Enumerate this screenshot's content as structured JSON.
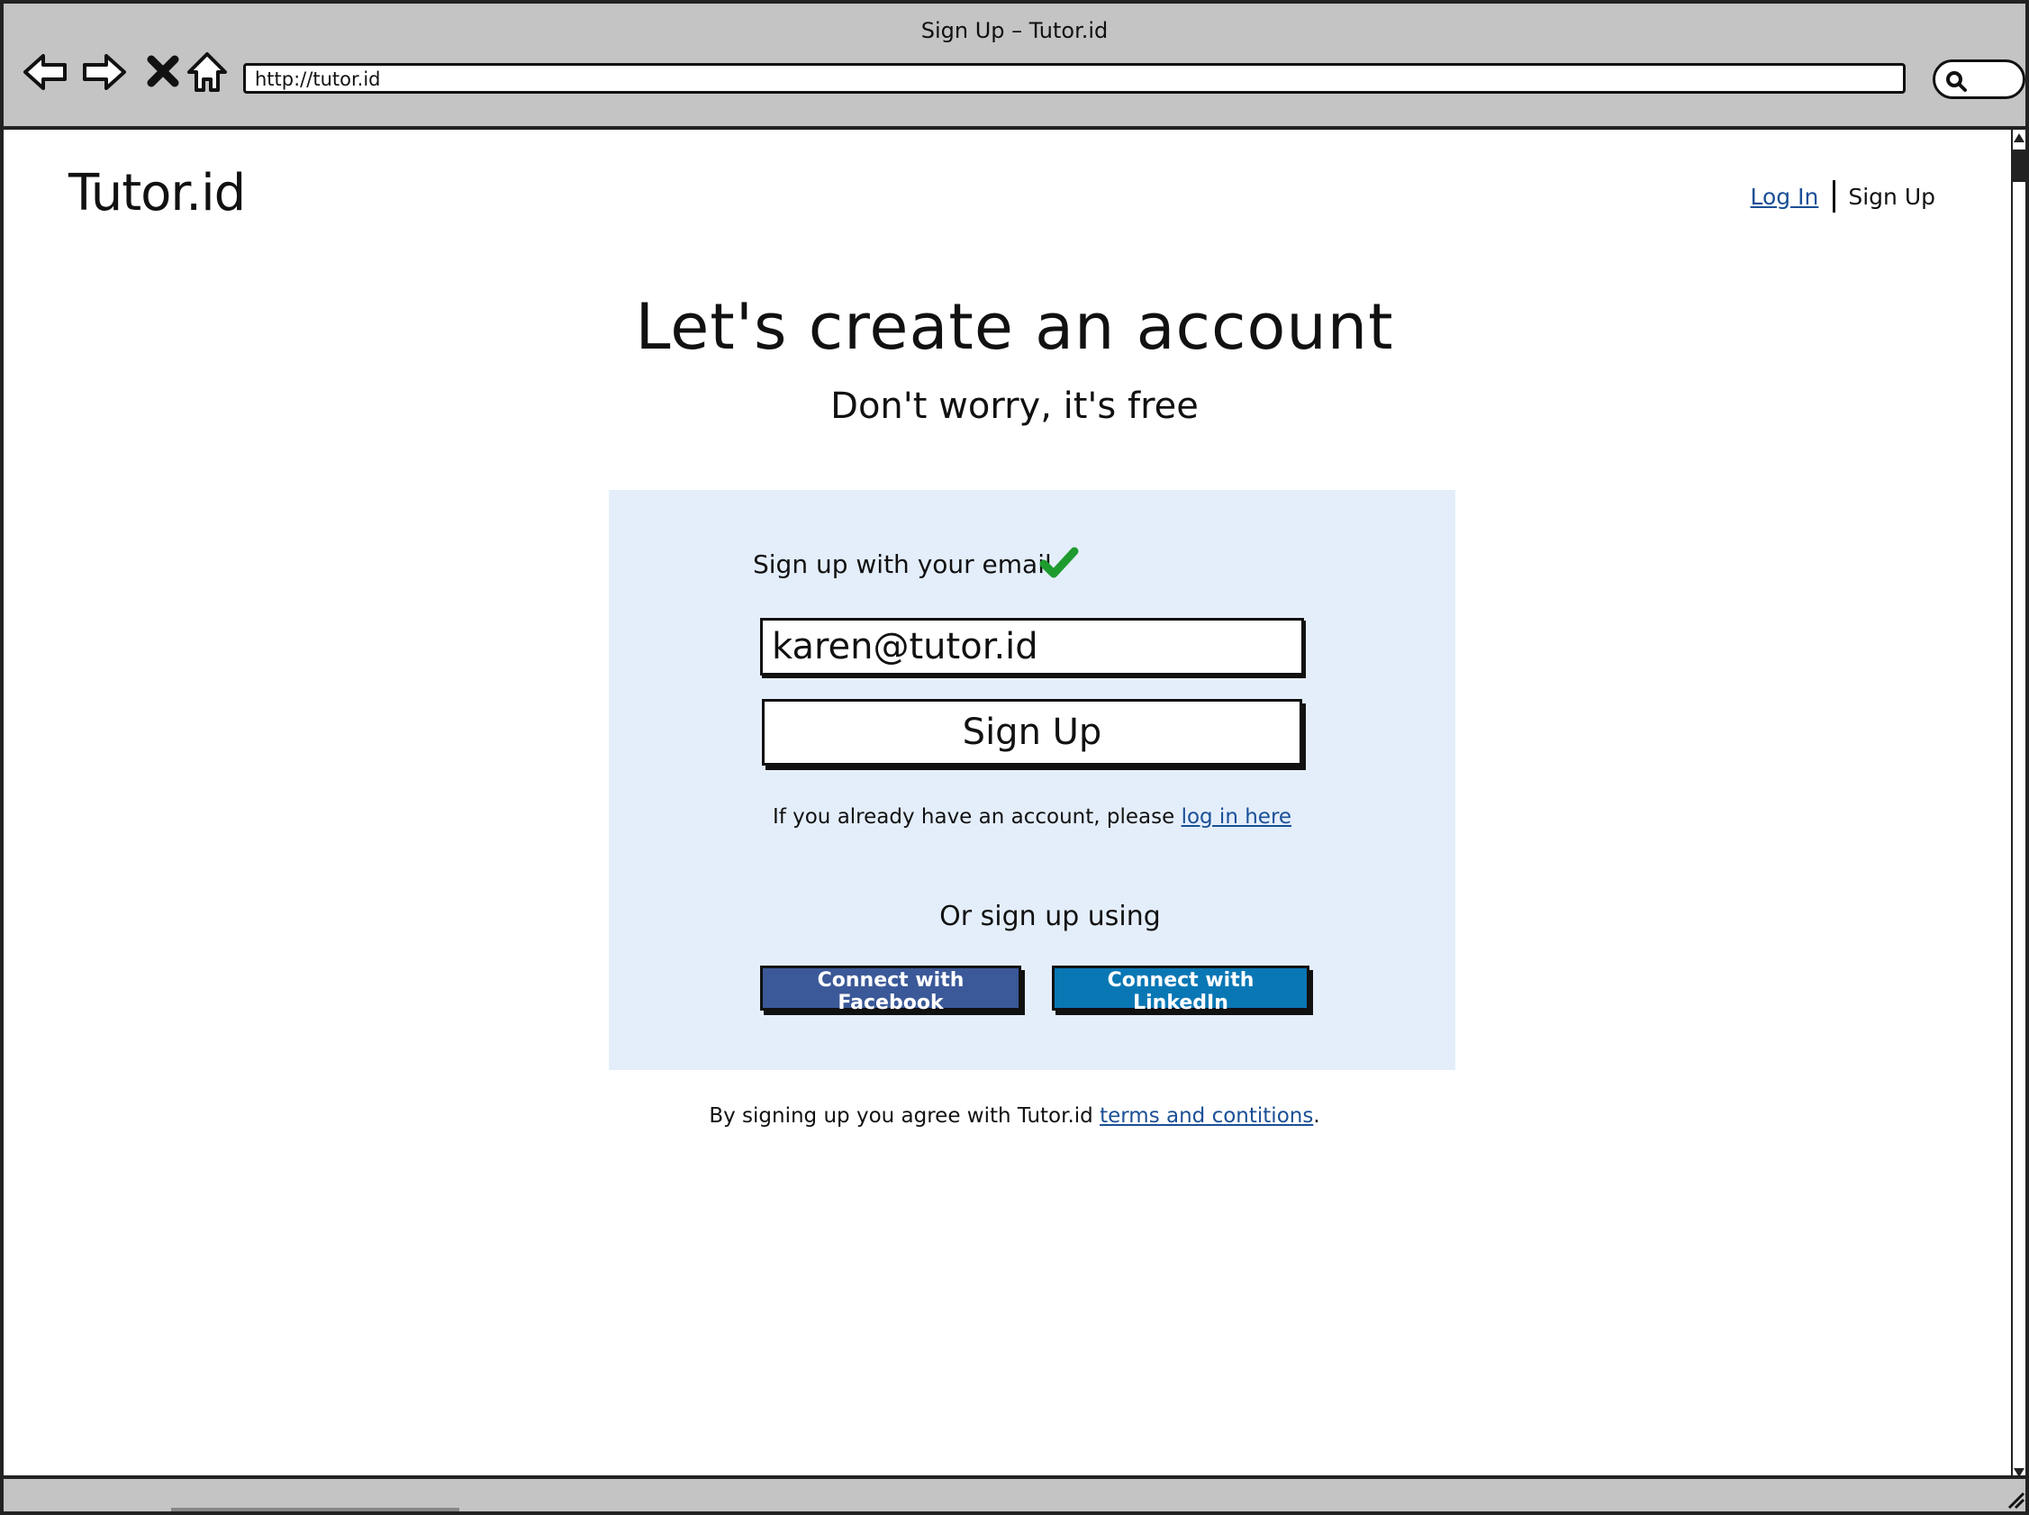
{
  "browser": {
    "window_title": "Sign Up – Tutor.id",
    "url": "http://tutor.id",
    "icons": [
      "back-arrow-icon",
      "forward-arrow-icon",
      "stop-icon",
      "home-icon",
      "search-icon"
    ]
  },
  "header": {
    "logo": "Tutor.id",
    "nav": {
      "login_label": "Log In",
      "signup_label": "Sign Up"
    }
  },
  "main": {
    "headline": "Let's create an account",
    "subheadline": "Don't worry, it's free",
    "form": {
      "email_label": "Sign up with your email",
      "email_value": "karen@tutor.id",
      "signup_button": "Sign Up",
      "login_prompt": "If you already have an account, please",
      "login_link": "log in here",
      "social_label": "Or sign up using",
      "facebook_button": "Connect with Facebook",
      "linkedin_button": "Connect with LinkedIn"
    },
    "terms_prefix": "By signing up you agree with Tutor.id",
    "terms_link": "terms and contitions",
    "terms_suffix": "."
  },
  "colors": {
    "panel_bg": "#e4eefb",
    "facebook": "#3b5998",
    "linkedin": "#0a77b5",
    "link": "#1a4f96",
    "check": "#1e9b2e"
  }
}
